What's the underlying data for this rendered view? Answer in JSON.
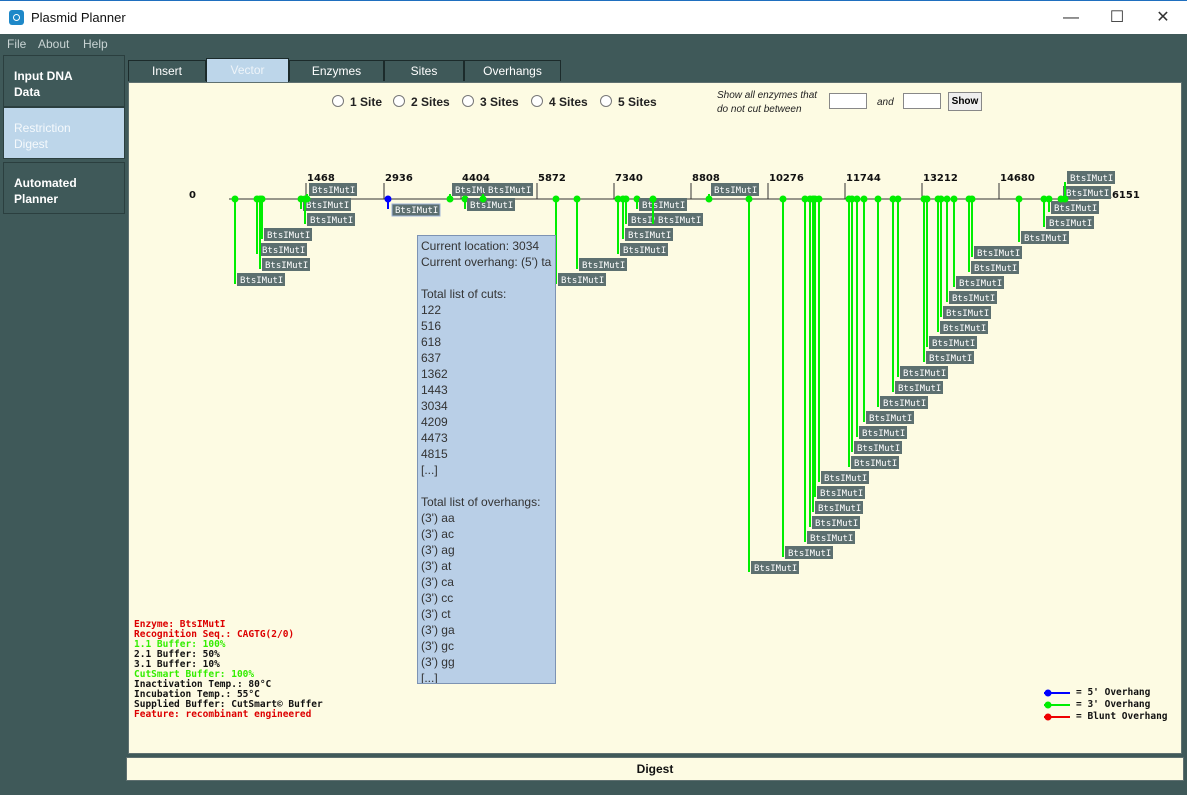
{
  "window": {
    "title": "Plasmid Planner",
    "minimize": "—",
    "maximize": "☐",
    "close": "✕"
  },
  "menu": [
    "File",
    "About",
    "Help"
  ],
  "sidebar": [
    {
      "label_l1": "Input DNA",
      "label_l2": "Data"
    },
    {
      "label_l1": "Restriction",
      "label_l2": "Digest"
    },
    {
      "label_l1": "Automated",
      "label_l2": "Planner"
    }
  ],
  "tabs": [
    "Insert",
    "Vector",
    "Enzymes",
    "Sites",
    "Overhangs"
  ],
  "filters": {
    "sites": [
      "1 Site",
      "2 Sites",
      "3 Sites",
      "4 Sites",
      "5 Sites"
    ],
    "show_label_1": "Show all enzymes that",
    "show_label_2": "do not cut between",
    "and_label": "and",
    "show_button": "Show",
    "from_value": "",
    "to_value": ""
  },
  "map": {
    "start_label": "0",
    "end_label": "16151",
    "ticks": [
      "1468",
      "2936",
      "4404",
      "5872",
      "7340",
      "8808",
      "10276",
      "11744",
      "13212",
      "14680"
    ],
    "enzyme_label": "BtsIMutI"
  },
  "info_box": {
    "current_location": "Current location: 3034",
    "current_overhang": "Current overhang: (5') ta",
    "cuts_header": "Total list of cuts:",
    "cuts": [
      "122",
      "516",
      "618",
      "637",
      "1362",
      "1443",
      "3034",
      "4209",
      "4473",
      "4815",
      "[...]"
    ],
    "overhangs_header": "Total list of overhangs:",
    "overhangs": [
      "(3') aa",
      "(3') ac",
      "(3') ag",
      "(3') at",
      "(3') ca",
      "(3') cc",
      "(3') ct",
      "(3') ga",
      "(3') gc",
      "(3') gg",
      "[...]"
    ]
  },
  "enzyme_info": {
    "enzyme": "Enzyme: BtsIMutI",
    "recognition": "Recognition Seq.: CAGTG(2/0)",
    "buffer_11": "1.1 Buffer: 100%",
    "buffer_21": "2.1 Buffer: 50%",
    "buffer_31": "3.1 Buffer: 10%",
    "cutsmart": "CutSmart Buffer: 100%",
    "inactivation": "Inactivation Temp.: 80°C",
    "incubation": "Incubation Temp.: 55°C",
    "supplied": "Supplied Buffer: CutSmart© Buffer",
    "feature": "Feature:  recombinant engineered"
  },
  "legend": [
    "= 5' Overhang",
    "= 3' Overhang",
    "= Blunt Overhang"
  ],
  "colors": {
    "five_prime": "#0000ff",
    "three_prime": "#00ee00",
    "blunt": "#ee0000",
    "label_bg": "#5d7070",
    "red_text": "#dd0000",
    "green_text": "#33ee00"
  },
  "digest_button": "Digest"
}
